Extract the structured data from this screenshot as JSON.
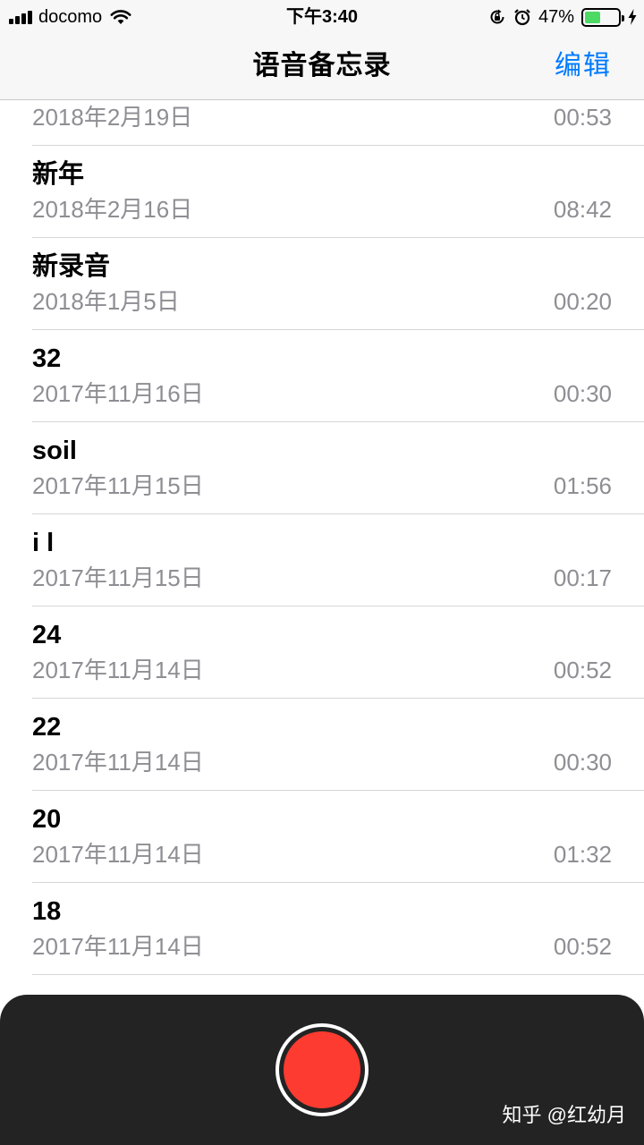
{
  "status_bar": {
    "carrier": "docomo",
    "time": "下午3:40",
    "battery_percent": "47%",
    "battery_level": 0.47,
    "icons": [
      "signal-icon",
      "wifi-icon",
      "rotation-lock-icon",
      "alarm-icon",
      "battery-icon",
      "charging-bolt-icon"
    ]
  },
  "nav": {
    "title": "语音备忘录",
    "edit_label": "编辑"
  },
  "memos": [
    {
      "title": "",
      "date": "2018年2月19日",
      "duration": "00:53"
    },
    {
      "title": "新年",
      "date": "2018年2月16日",
      "duration": "08:42"
    },
    {
      "title": "新录音",
      "date": "2018年1月5日",
      "duration": "00:20"
    },
    {
      "title": "32",
      "date": "2017年11月16日",
      "duration": "00:30"
    },
    {
      "title": "soil",
      "date": "2017年11月15日",
      "duration": "01:56"
    },
    {
      "title": "i l",
      "date": "2017年11月15日",
      "duration": "00:17"
    },
    {
      "title": "24",
      "date": "2017年11月14日",
      "duration": "00:52"
    },
    {
      "title": "22",
      "date": "2017年11月14日",
      "duration": "00:30"
    },
    {
      "title": "20",
      "date": "2017年11月14日",
      "duration": "01:32"
    },
    {
      "title": "18",
      "date": "2017年11月14日",
      "duration": "00:52"
    }
  ],
  "record_panel": {
    "record_button_color": "#fd3b30",
    "watermark": "知乎 @红幼月"
  },
  "colors": {
    "accent": "#007aff",
    "secondary_text": "#8e8e93",
    "panel_background": "#232323"
  }
}
